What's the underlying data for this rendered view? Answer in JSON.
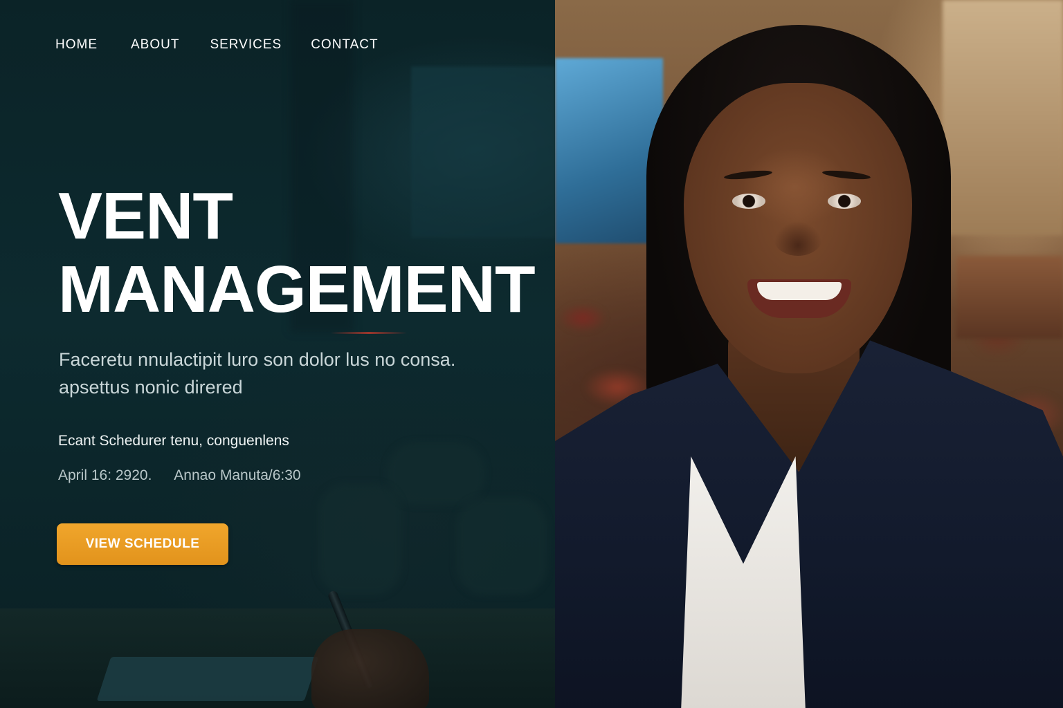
{
  "nav": {
    "items": [
      "HOME",
      "ABOUT",
      "SERVICES",
      "CONTACT"
    ]
  },
  "hero": {
    "title_line1": "VENT",
    "title_line2": "MANAGEMENT",
    "subtitle_line1": "Faceretu nnulactipit luro son dolor lus no consa.",
    "subtitle_line2": "apsettus nonic direred",
    "event_line": "Ecant Schedurer tenu, conguenlens",
    "event_date": "April 16: 2920.",
    "event_location": "Annao Manuta/6:30",
    "cta_label": "VIEW SCHEDULE"
  },
  "colors": {
    "left_panel_bg": "#0c2328",
    "cta": "#e99e25",
    "text_primary": "#ffffff"
  },
  "photo": {
    "subject": "smiling woman in dark blazer at conference"
  }
}
